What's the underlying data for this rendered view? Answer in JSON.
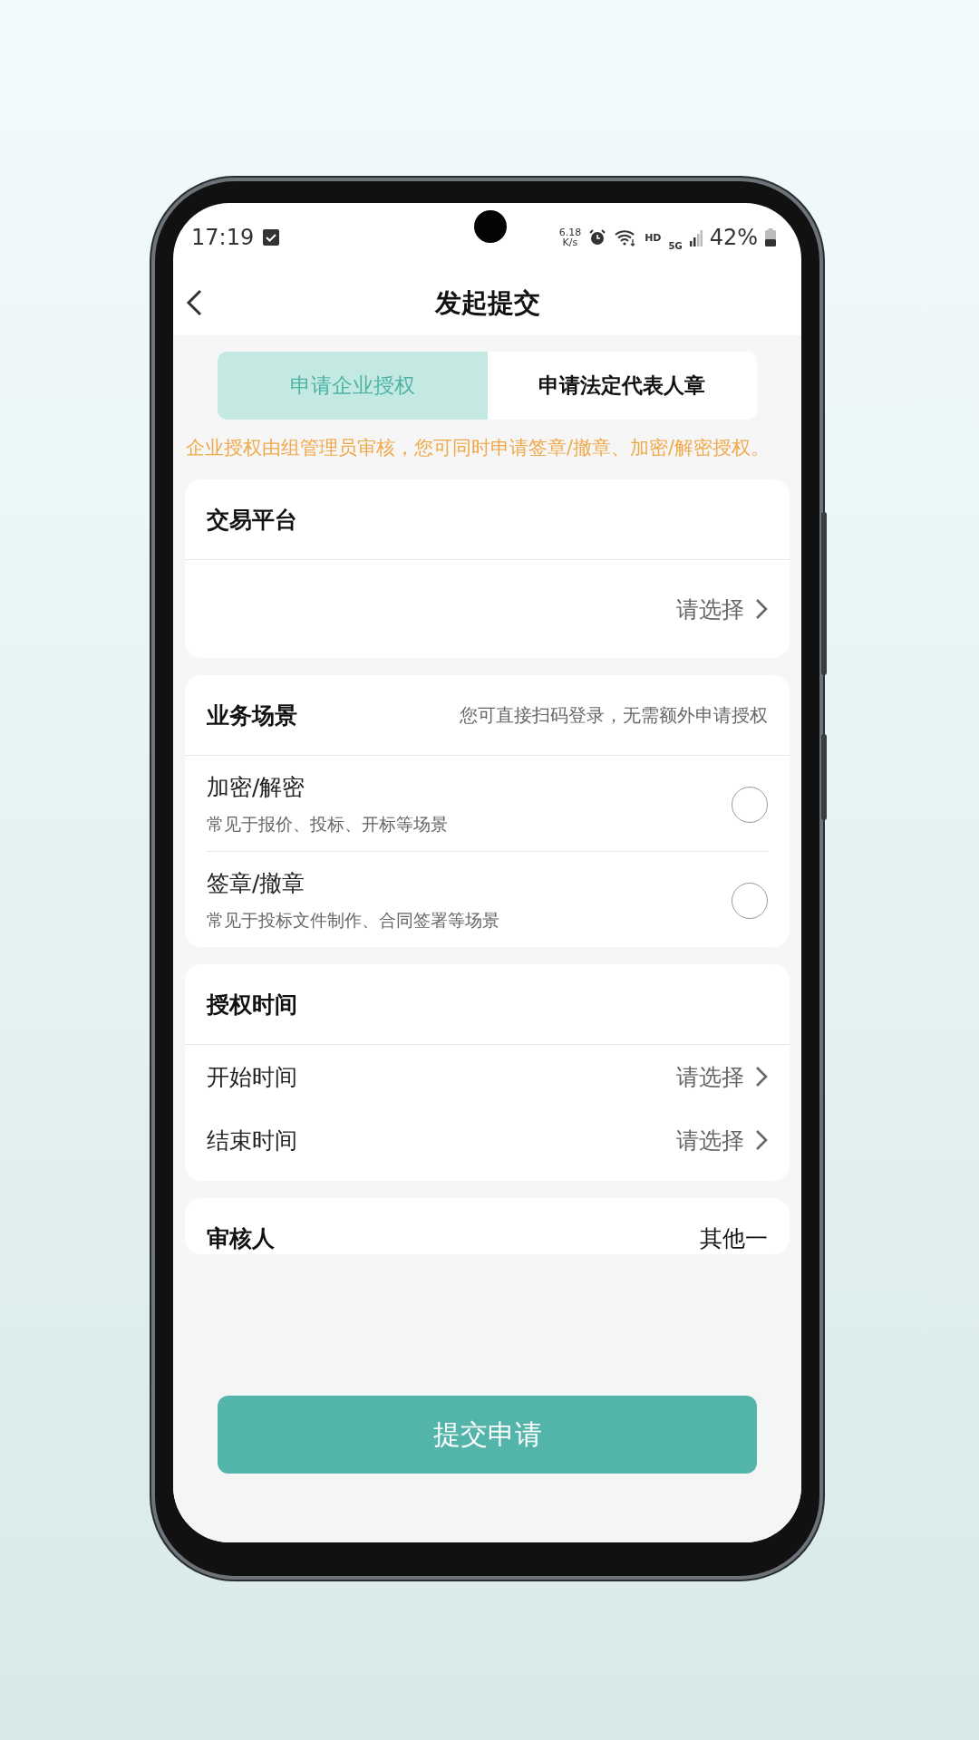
{
  "status_bar": {
    "time": "17:19",
    "net_speed": "6.18",
    "net_unit": "K/s",
    "network": "HD",
    "signal_type": "5G",
    "battery": "42%"
  },
  "header": {
    "title": "发起提交"
  },
  "tabs": [
    {
      "label": "申请企业授权",
      "selected": true
    },
    {
      "label": "申请法定代表人章",
      "selected": false
    }
  ],
  "notice": "企业授权由组管理员审核，您可同时申请签章/撤章、加密/解密授权。",
  "sections": [
    {
      "title": "交易平台",
      "rows": [
        {
          "kind": "select",
          "value": "请选择"
        }
      ]
    },
    {
      "title": "业务场景",
      "hint": "您可直接扫码登录，无需额外申请授权",
      "rows": [
        {
          "kind": "option",
          "label": "加密/解密",
          "description": "常见于报价、投标、开标等场景",
          "checked": false
        },
        {
          "kind": "option",
          "label": "签章/撤章",
          "description": "常见于投标文件制作、合同签署等场景",
          "checked": false
        }
      ]
    },
    {
      "title": "授权时间",
      "rows": [
        {
          "kind": "select",
          "label": "开始时间",
          "value": "请选择"
        },
        {
          "kind": "select",
          "label": "结束时间",
          "value": "请选择"
        }
      ]
    },
    {
      "title": "审核人",
      "value": "其他一"
    }
  ],
  "submit_button": "提交申请"
}
